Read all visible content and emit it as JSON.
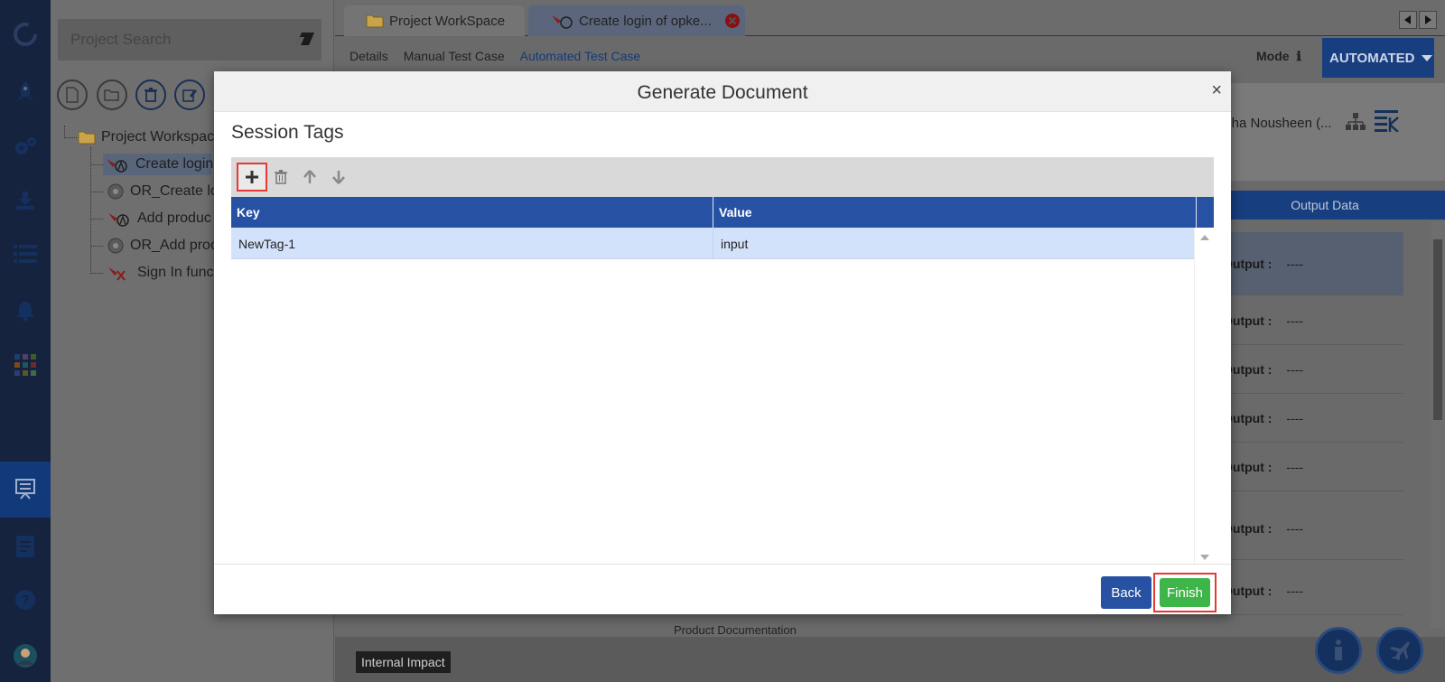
{
  "app": {
    "search": {
      "placeholder": "Project Search"
    },
    "tree": {
      "root": "Project Workspac",
      "items": [
        "Create login",
        "OR_Create lo",
        "Add produc",
        "OR_Add proc",
        "Sign In func"
      ]
    },
    "tabs": [
      {
        "label": "Project WorkSpace"
      },
      {
        "label": "Create login of opke..."
      }
    ],
    "subnav": [
      "Details",
      "Manual Test Case",
      "Automated Test Case"
    ],
    "mode": {
      "label": "Mode",
      "value": "AUTOMATED"
    },
    "owner_text": "areha Nousheen (...",
    "output": {
      "header": "Output Data",
      "rows": [
        {
          "label": "Output :",
          "value": "----"
        },
        {
          "label": "Output :",
          "value": "----"
        },
        {
          "label": "Output :",
          "value": "----"
        },
        {
          "label": "Output :",
          "value": "----"
        },
        {
          "label": "Output :",
          "value": "----"
        },
        {
          "label": "Output :",
          "value": "----"
        },
        {
          "label": "Output :",
          "value": "----"
        }
      ]
    },
    "partial_text": "Product Documentation",
    "internal_impact": "Internal Impact"
  },
  "modal": {
    "title": "Generate Document",
    "close": "×",
    "section_title": "Session Tags",
    "columns": {
      "key": "Key",
      "value": "Value"
    },
    "rows": [
      {
        "key": "NewTag-1",
        "value": "input"
      }
    ],
    "buttons": {
      "back": "Back",
      "finish": "Finish"
    }
  },
  "colors": {
    "primary": "#2752a3",
    "finish": "#3eb548",
    "highlight": "#e53935",
    "selected_row": "#d3e2fb"
  }
}
